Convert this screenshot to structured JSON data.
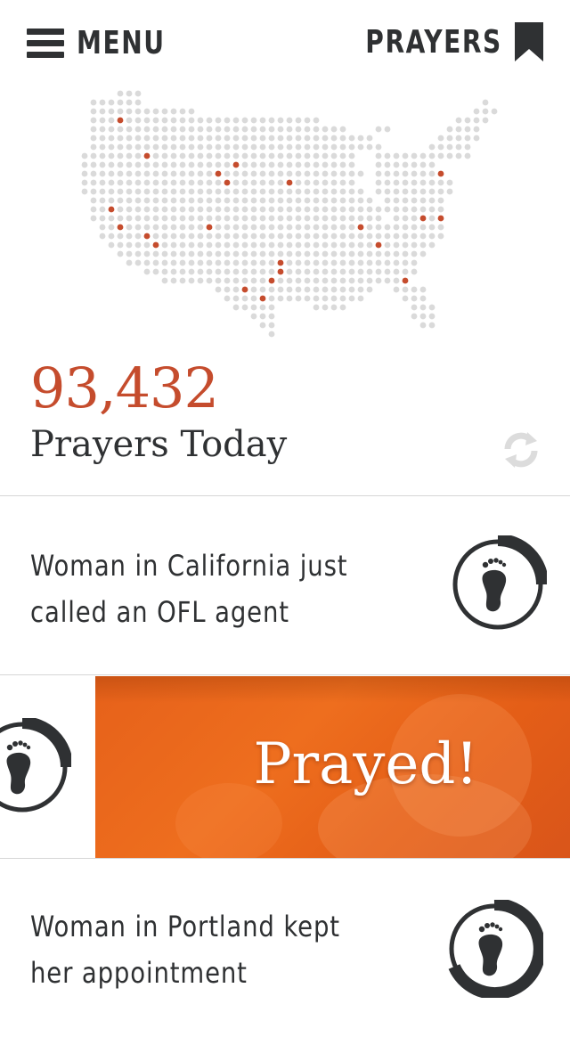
{
  "header": {
    "menu_label": "MENU",
    "prayers_label": "PRAYERS",
    "menu_icon": "hamburger-icon",
    "prayers_icon": "bookmark-icon"
  },
  "map": {
    "icon": "us-dot-map",
    "dot_color": "#dadada",
    "highlight_color": "#c54c2d"
  },
  "stats": {
    "count": "93,432",
    "label": "Prayers Today",
    "refresh_icon": "refresh-icon"
  },
  "feed": [
    {
      "text": "Woman in California just called an OFL agent",
      "icon": "footprint-icon",
      "progress": 0.25
    },
    {
      "text": "Prayed!",
      "icon": "footprint-icon",
      "progress": 0.25,
      "state": "prayed"
    },
    {
      "text": "Woman in Portland kept her appointment",
      "icon": "footprint-icon",
      "progress": 0.55
    }
  ],
  "colors": {
    "accent": "#c54c2d",
    "banner": "#e6611a",
    "text": "#2f3133"
  }
}
